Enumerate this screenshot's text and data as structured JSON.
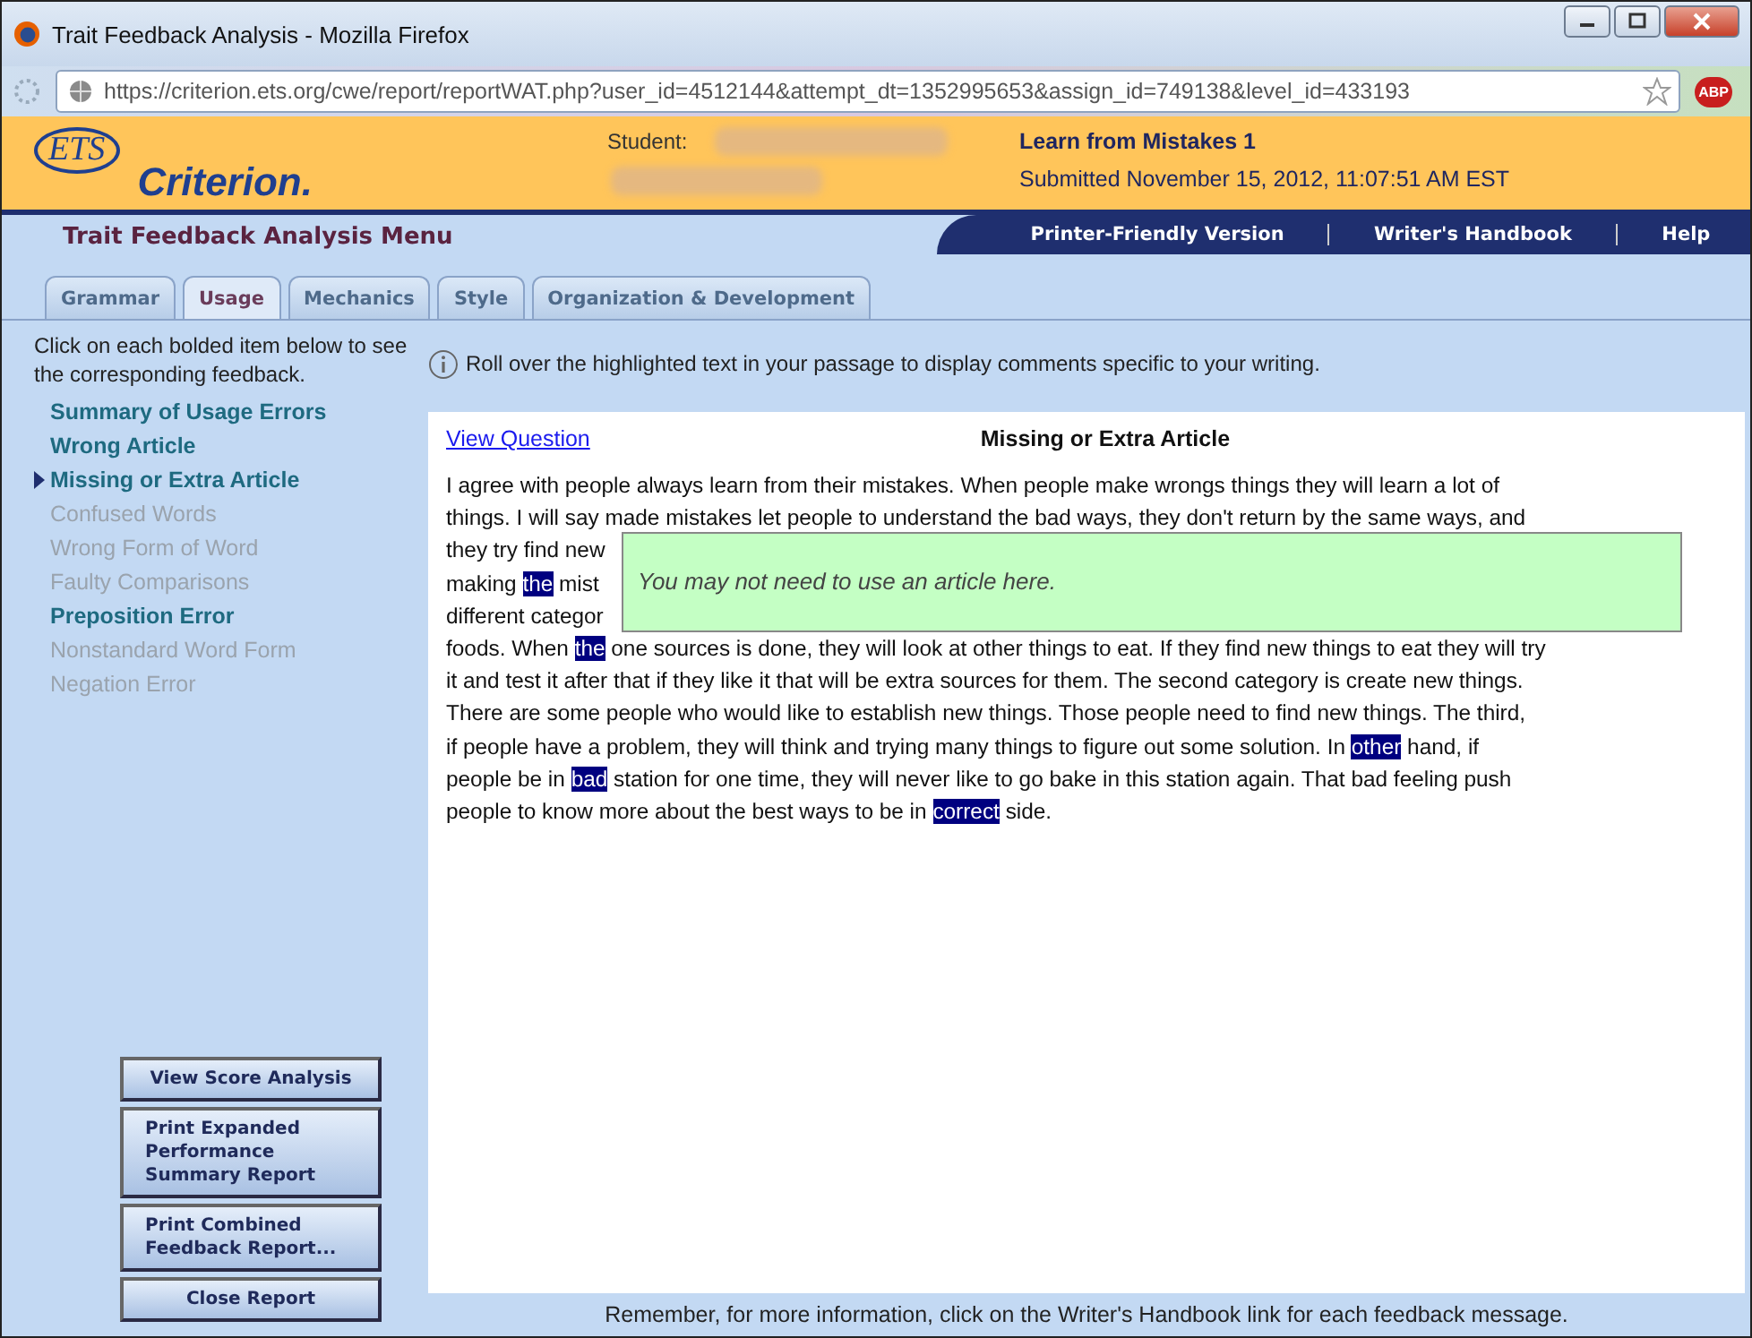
{
  "window": {
    "title": "Trait Feedback Analysis - Mozilla Firefox"
  },
  "address_bar": {
    "url": "https://criterion.ets.org/cwe/report/reportWAT.php?user_id=4512144&attempt_dt=1352995653&assign_id=749138&level_id=433193",
    "addon_badge": "ABP"
  },
  "header": {
    "logo_oval": "ETS",
    "logo_word": "Criterion.",
    "student_label": "Student:",
    "assignment": "Learn from Mistakes 1",
    "submitted": "Submitted November 15, 2012, 11:07:51 AM EST"
  },
  "menu_title": "Trait Feedback Analysis Menu",
  "nav_links": [
    "Printer-Friendly Version",
    "Writer's Handbook",
    "Help"
  ],
  "tabs": [
    {
      "label": "Grammar",
      "selected": false
    },
    {
      "label": "Usage",
      "selected": true
    },
    {
      "label": "Mechanics",
      "selected": false
    },
    {
      "label": "Style",
      "selected": false
    },
    {
      "label": "Organization & Development",
      "selected": false
    }
  ],
  "sidebar": {
    "instructions": "Click on each bolded item below to see the corresponding feedback.",
    "items": [
      {
        "label": "Summary of Usage Errors",
        "enabled": true,
        "selected": false
      },
      {
        "label": "Wrong Article",
        "enabled": true,
        "selected": false
      },
      {
        "label": "Missing or Extra Article",
        "enabled": true,
        "selected": true
      },
      {
        "label": "Confused Words",
        "enabled": false,
        "selected": false
      },
      {
        "label": "Wrong Form of Word",
        "enabled": false,
        "selected": false
      },
      {
        "label": "Faulty Comparisons",
        "enabled": false,
        "selected": false
      },
      {
        "label": "Preposition Error",
        "enabled": true,
        "selected": false
      },
      {
        "label": "Nonstandard Word Form",
        "enabled": false,
        "selected": false
      },
      {
        "label": "Negation Error",
        "enabled": false,
        "selected": false
      }
    ],
    "buttons": [
      "View Score Analysis",
      "Print Expanded Performance Summary Report",
      "Print Combined Feedback Report...",
      "Close Report"
    ]
  },
  "hint": "Roll over the highlighted text in your passage to display comments specific to your writing.",
  "panel": {
    "link": "View Question",
    "heading": "Missing or Extra Article",
    "lines": [
      {
        "segments": [
          {
            "text": "I agree with people always learn from their mistakes. When people make wrongs things they will learn a lot of",
            "highlighted": false
          }
        ]
      },
      {
        "segments": [
          {
            "text": "things. I will say made mistakes let people to understand the bad ways, they don't return by the same ways, and",
            "highlighted": false
          }
        ]
      },
      {
        "segments": [
          {
            "text": "they try find new",
            "highlighted": false
          }
        ]
      },
      {
        "segments": [
          {
            "text": "making ",
            "highlighted": false
          },
          {
            "text": "the",
            "highlighted": true
          },
          {
            "text": " mist",
            "highlighted": false
          }
        ]
      },
      {
        "segments": [
          {
            "text": "different categor",
            "highlighted": false
          }
        ]
      },
      {
        "segments": [
          {
            "text": "foods. When ",
            "highlighted": false
          },
          {
            "text": "the",
            "highlighted": true
          },
          {
            "text": " one sources is done, they will look at other things to eat. If they find new things to eat they will try",
            "highlighted": false
          }
        ]
      },
      {
        "segments": [
          {
            "text": "it and test it after that if they like it that will be extra sources for them. The second category is create new things.",
            "highlighted": false
          }
        ]
      },
      {
        "segments": [
          {
            "text": "There are some people who would like to establish new things. Those people need to find new things. The third,",
            "highlighted": false
          }
        ]
      },
      {
        "segments": [
          {
            "text": "if people have a problem, they will think and trying many things to figure out some solution. In ",
            "highlighted": false
          },
          {
            "text": "other",
            "highlighted": true
          },
          {
            "text": " hand, if",
            "highlighted": false
          }
        ]
      },
      {
        "segments": [
          {
            "text": "people be in ",
            "highlighted": false
          },
          {
            "text": "bad",
            "highlighted": true
          },
          {
            "text": " station for one time, they will never like to go bake in this station again. That bad feeling push",
            "highlighted": false
          }
        ]
      },
      {
        "segments": [
          {
            "text": "people to know more about the best ways to be in ",
            "highlighted": false
          },
          {
            "text": "correct",
            "highlighted": true
          },
          {
            "text": " side.",
            "highlighted": false
          }
        ]
      }
    ],
    "tooltip": "You may not need to use an article here."
  },
  "footer": "Remember, for more information, click on the Writer's Handbook link for each feedback message."
}
